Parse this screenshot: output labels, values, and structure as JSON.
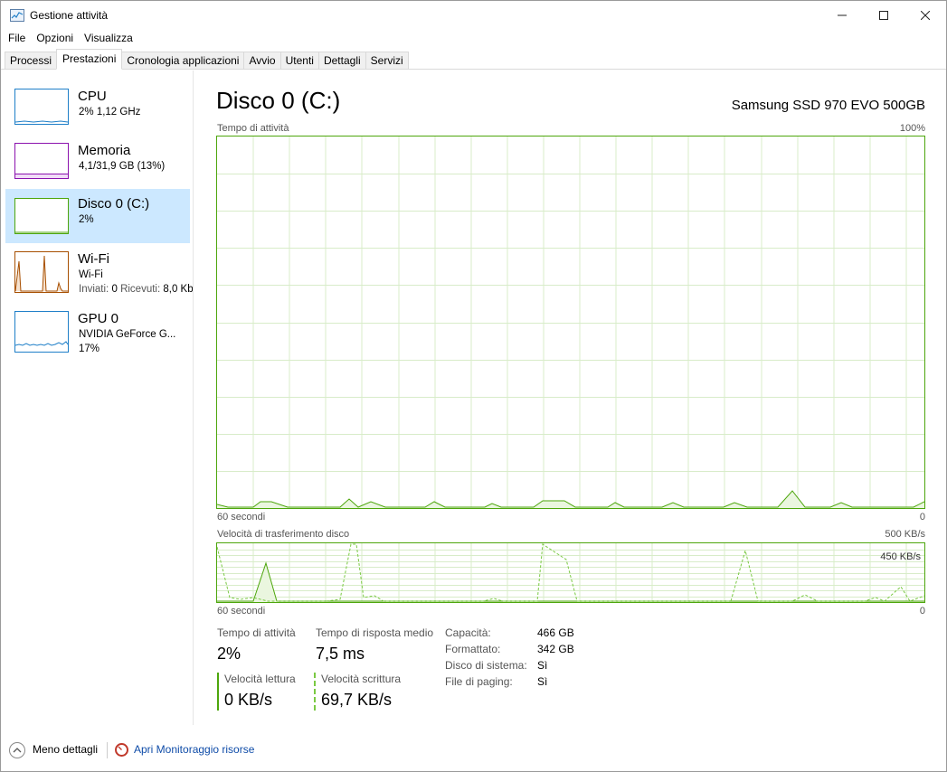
{
  "window": {
    "title": "Gestione attività"
  },
  "menu": [
    "File",
    "Opzioni",
    "Visualizza"
  ],
  "tabs": [
    "Processi",
    "Prestazioni",
    "Cronologia applicazioni",
    "Avvio",
    "Utenti",
    "Dettagli",
    "Servizi"
  ],
  "active_tab": "Prestazioni",
  "resources": [
    {
      "name": "CPU",
      "line1": "2% 1,12 GHz",
      "line2": "",
      "color": "#1f7fc8"
    },
    {
      "name": "Memoria",
      "line1": "4,1/31,9 GB (13%)",
      "line2": "",
      "color": "#8b12ae"
    },
    {
      "name": "Disco 0 (C:)",
      "line1": "2%",
      "line2": "",
      "color": "#4da60c"
    },
    {
      "name": "Wi-Fi",
      "line1": "Wi-Fi",
      "line2_prefix": "Inviati:",
      "line2_sent": "0",
      "line2_mid": "Ricevuti:",
      "line2_recv": "8,0 Kb",
      "color": "#a74f01"
    },
    {
      "name": "GPU 0",
      "line1": "NVIDIA GeForce G...",
      "line2": "17%",
      "color": "#1f7fc8"
    }
  ],
  "disk": {
    "title": "Disco 0 (C:)",
    "model": "Samsung SSD 970 EVO 500GB",
    "activity_graph": {
      "label": "Tempo di attività",
      "max": "100%",
      "time_label": "60 secondi",
      "min": "0"
    },
    "transfer_graph": {
      "label": "Velocità di trasferimento disco",
      "max": "500 KB/s",
      "inner_max": "450 KB/s",
      "time_label": "60 secondi",
      "min": "0"
    },
    "stats": {
      "active_time_label": "Tempo di attività",
      "active_time_value": "2%",
      "response_label": "Tempo di risposta medio",
      "response_value": "7,5 ms",
      "read_label": "Velocità lettura",
      "read_value": "0 KB/s",
      "write_label": "Velocità scrittura",
      "write_value": "69,7 KB/s"
    },
    "properties": [
      {
        "key": "Capacità:",
        "value": "466 GB"
      },
      {
        "key": "Formattato:",
        "value": "342 GB"
      },
      {
        "key": "Disco di sistema:",
        "value": "Sì"
      },
      {
        "key": "File di paging:",
        "value": "Sì"
      }
    ]
  },
  "footer": {
    "less_details": "Meno dettagli",
    "open_monitor": "Apri Monitoraggio risorse"
  },
  "colors": {
    "disk": "#4da60c",
    "selection": "#cce8ff",
    "link": "#0f4ca8"
  }
}
